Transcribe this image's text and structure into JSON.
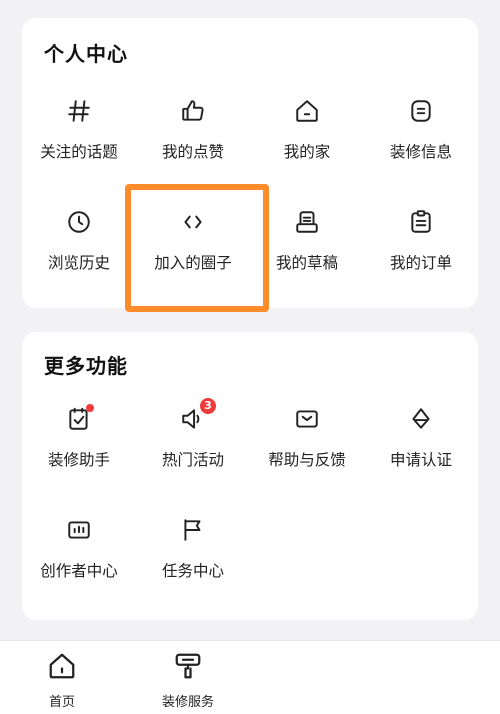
{
  "personal": {
    "title": "个人中心",
    "items": [
      {
        "label": "关注的话题",
        "icon": "hash-icon"
      },
      {
        "label": "我的点赞",
        "icon": "thumbs-up-icon"
      },
      {
        "label": "我的家",
        "icon": "home-icon"
      },
      {
        "label": "装修信息",
        "icon": "document-icon"
      },
      {
        "label": "浏览历史",
        "icon": "clock-icon"
      },
      {
        "label": "加入的圈子",
        "icon": "code-brackets-icon"
      },
      {
        "label": "我的草稿",
        "icon": "draft-icon"
      },
      {
        "label": "我的订单",
        "icon": "clipboard-icon"
      }
    ]
  },
  "more": {
    "title": "更多功能",
    "items": [
      {
        "label": "装修助手",
        "icon": "checklist-icon",
        "dot": true
      },
      {
        "label": "热门活动",
        "icon": "megaphone-icon",
        "badge": "3"
      },
      {
        "label": "帮助与反馈",
        "icon": "mail-icon"
      },
      {
        "label": "申请认证",
        "icon": "pen-nib-icon"
      },
      {
        "label": "创作者中心",
        "icon": "chart-box-icon"
      },
      {
        "label": "任务中心",
        "icon": "flag-icon"
      }
    ]
  },
  "tabbar": {
    "home": "首页",
    "decoration_service": "装修服务"
  },
  "colors": {
    "highlight": "#ff8c2a",
    "badge": "#ee3b3b",
    "background": "#f2f2f4"
  }
}
